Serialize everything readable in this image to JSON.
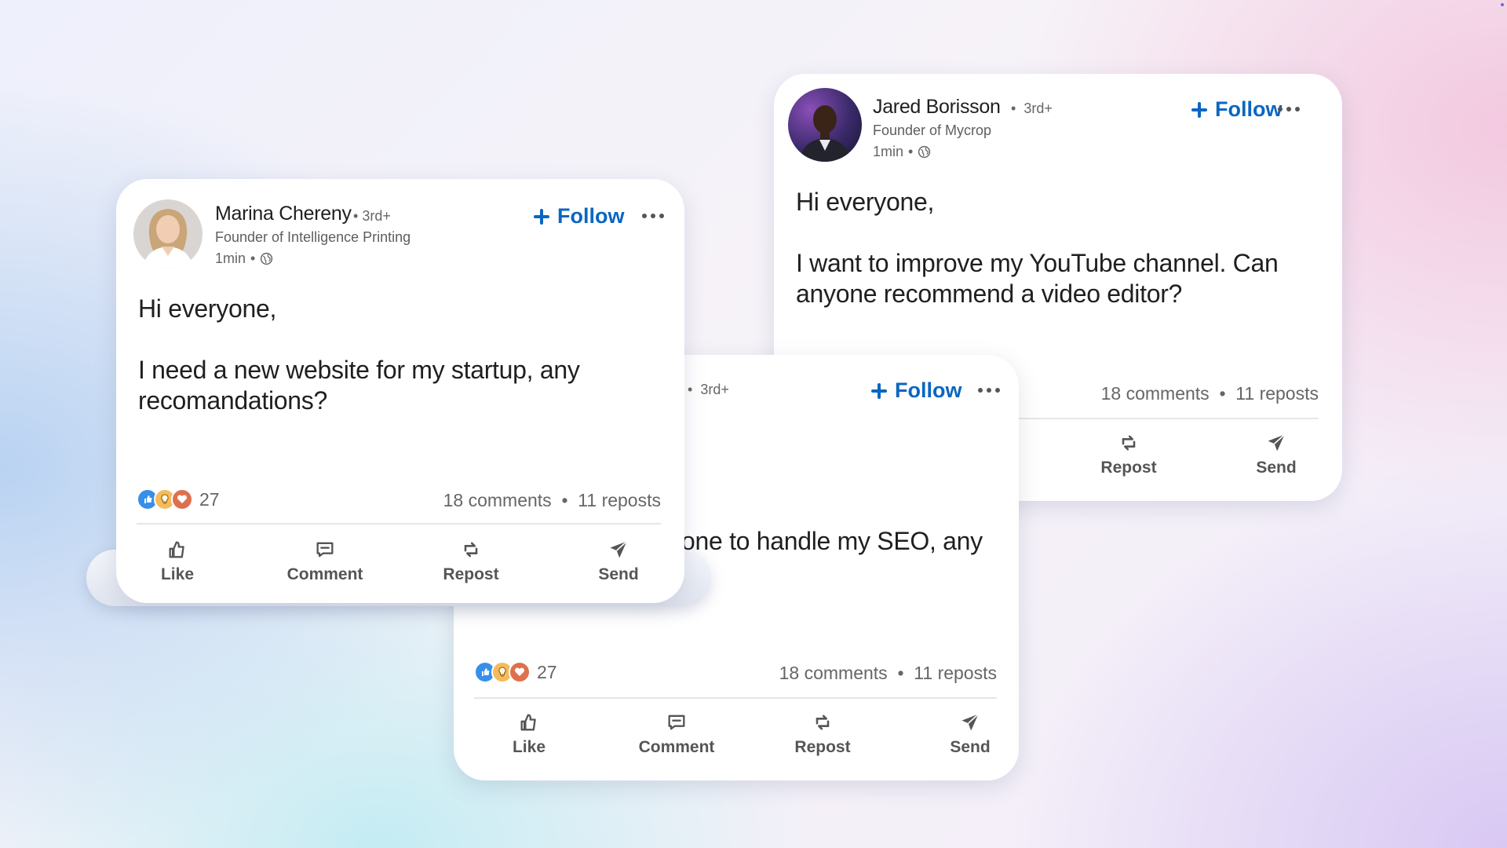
{
  "posts": [
    {
      "name": "Marina Chereny",
      "degree": "3rd+",
      "headline": "Founder of Intelligence Printing",
      "time": "1min",
      "follow_label": "Follow",
      "line1": "Hi everyone,",
      "line2": "I need a new website for my startup, any recomandations?",
      "reaction_count": "27",
      "comments": "18 comments",
      "reposts": "11 reposts",
      "actions": {
        "like": "Like",
        "comment": "Comment",
        "repost": "Repost",
        "send": "Send"
      }
    },
    {
      "degree": "3rd+",
      "follow_label": "Follow",
      "line2_visible": "one to handle my SEO, any",
      "reaction_count": "27",
      "comments": "18 comments",
      "reposts": "11 reposts",
      "actions": {
        "like": "Like",
        "comment": "Comment",
        "repost": "Repost",
        "send": "Send"
      }
    },
    {
      "name": "Jared Borisson",
      "degree": "3rd+",
      "headline": "Founder of Mycrop",
      "time": "1min",
      "follow_label": "Follow",
      "line1": "Hi everyone,",
      "line2": "I want to improve my YouTube channel. Can anyone recommend a video editor?",
      "comments": "18 comments",
      "reposts": "11 reposts",
      "actions": {
        "repost": "Repost",
        "send": "Send"
      }
    }
  ],
  "separator": "•",
  "colors": {
    "follow_blue": "#0a66c2",
    "like_blue": "#378fe9",
    "insight_orange": "#f5bb5c",
    "love_red": "#df704d"
  },
  "icons": [
    "globe-icon",
    "plus-icon",
    "more-icon",
    "like-icon",
    "comment-icon",
    "repost-icon",
    "send-icon",
    "like-reaction-icon",
    "insightful-reaction-icon",
    "love-reaction-icon"
  ]
}
